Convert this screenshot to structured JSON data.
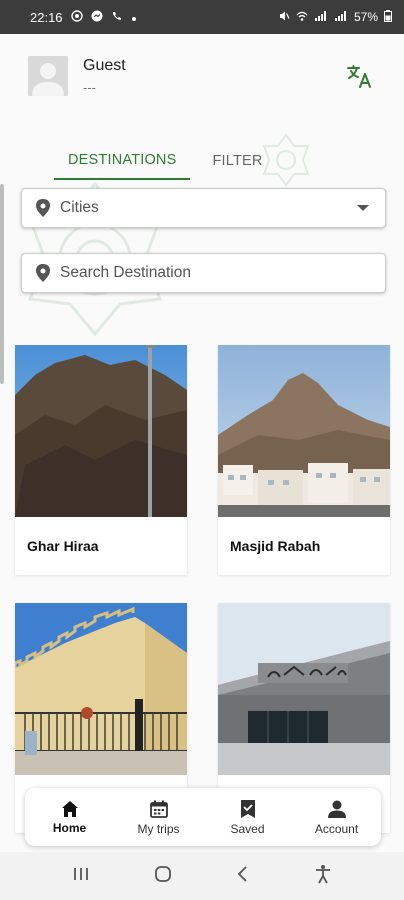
{
  "status_bar": {
    "time": "22:16",
    "battery": "57%",
    "left_icons": [
      "whatsapp-icon",
      "messenger-icon",
      "phone-icon",
      "dot-icon"
    ],
    "right_icons": [
      "mute-icon",
      "wifi-call-icon",
      "signal-icon",
      "signal-icon",
      "battery-icon"
    ]
  },
  "header": {
    "user_name": "Guest",
    "user_sub": "---",
    "translate_icon": "translate-icon",
    "accent_color": "#2e7d32"
  },
  "tabs": [
    {
      "label": "DESTINATIONS",
      "active": true
    },
    {
      "label": "FILTER",
      "active": false
    }
  ],
  "cities_select": {
    "value": "Cities"
  },
  "search": {
    "placeholder": "Search Destination"
  },
  "destinations": [
    {
      "name": "Ghar Hiraa"
    },
    {
      "name": "Masjid Rabah"
    },
    {
      "name": ""
    },
    {
      "name": ""
    }
  ],
  "bottom_nav": [
    {
      "label": "Home",
      "icon": "home-icon",
      "active": true
    },
    {
      "label": "My trips",
      "icon": "calendar-icon",
      "active": false
    },
    {
      "label": "Saved",
      "icon": "bookmark-icon",
      "active": false
    },
    {
      "label": "Account",
      "icon": "account-icon",
      "active": false
    }
  ],
  "system_nav": [
    "recents-icon",
    "home-circle-icon",
    "back-icon",
    "accessibility-icon"
  ]
}
